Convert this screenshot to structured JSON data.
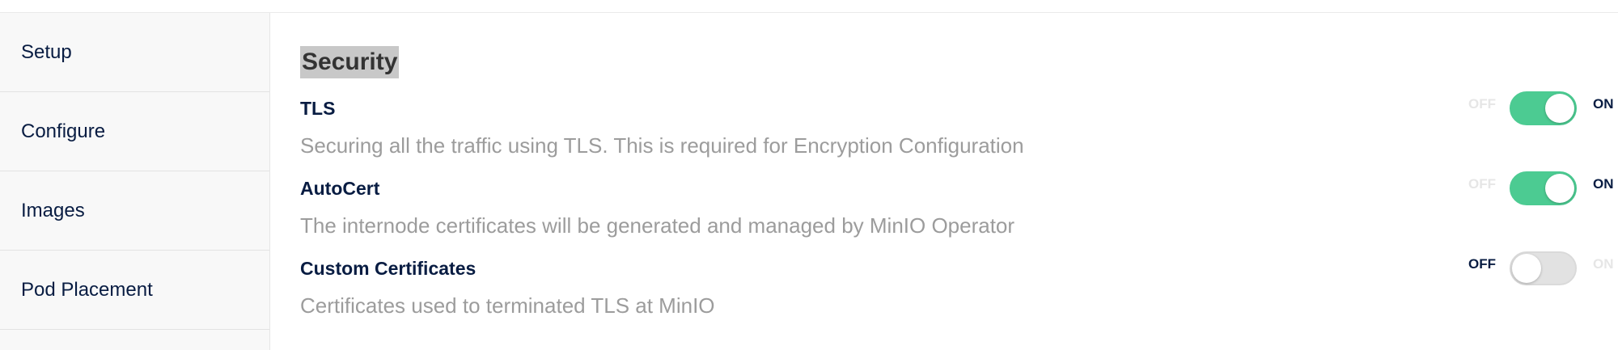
{
  "sidebar": {
    "items": [
      {
        "label": "Setup"
      },
      {
        "label": "Configure"
      },
      {
        "label": "Images"
      },
      {
        "label": "Pod Placement"
      }
    ]
  },
  "section": {
    "title": "Security"
  },
  "settings": [
    {
      "label": "TLS",
      "description": "Securing all the traffic using TLS. This is required for Encryption Configuration",
      "off_label": "OFF",
      "on_label": "ON",
      "state": "on"
    },
    {
      "label": "AutoCert",
      "description": "The internode certificates will be generated and managed by MinIO Operator",
      "off_label": "OFF",
      "on_label": "ON",
      "state": "on"
    },
    {
      "label": "Custom Certificates",
      "description": "Certificates used to terminated TLS at MinIO",
      "off_label": "OFF",
      "on_label": "ON",
      "state": "off"
    }
  ],
  "colors": {
    "toggle_on": "#4ccb92",
    "toggle_off": "#e2e2e2",
    "label_dark": "#081c42",
    "description_gray": "#9c9c9c"
  }
}
